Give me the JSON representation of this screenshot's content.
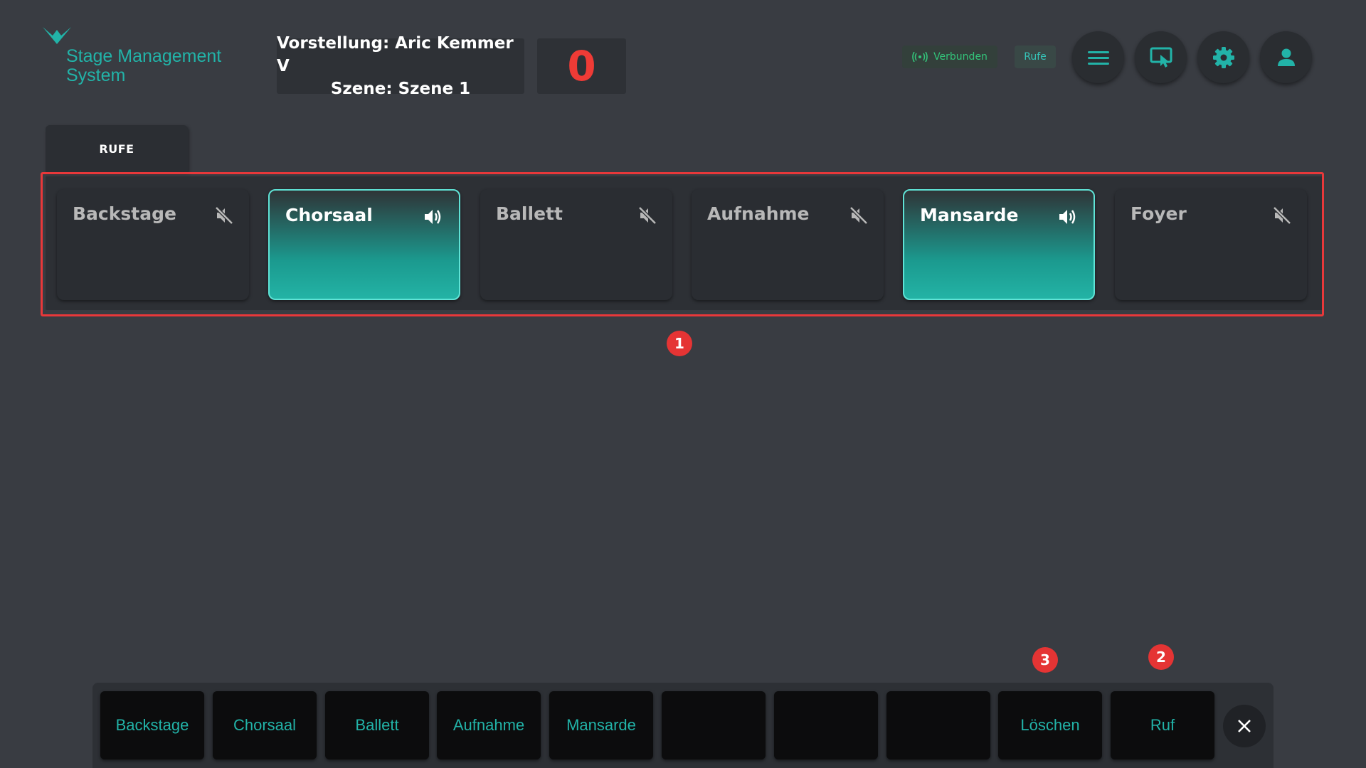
{
  "header": {
    "logo_text_line1": "Stage Management",
    "logo_text_line2": "System",
    "show_label": "Vorstellung: Aric Kemmer V",
    "scene_label": "Szene: Szene 1",
    "counter": "0",
    "status": "Verbunden",
    "rufe_badge": "Rufe",
    "buttons": [
      "menu-icon",
      "touch-screen-icon",
      "gear-icon",
      "user-icon"
    ]
  },
  "tab": {
    "label": "RUFE"
  },
  "stations": [
    {
      "label": "Backstage",
      "active": false,
      "icon": "muted-speaker-icon"
    },
    {
      "label": "Chorsaal",
      "active": true,
      "icon": "speaker-icon"
    },
    {
      "label": "Ballett",
      "active": false,
      "icon": "muted-speaker-icon"
    },
    {
      "label": "Aufnahme",
      "active": false,
      "icon": "muted-speaker-icon"
    },
    {
      "label": "Mansarde",
      "active": true,
      "icon": "speaker-icon"
    },
    {
      "label": "Foyer",
      "active": false,
      "icon": "muted-speaker-icon"
    }
  ],
  "markers": [
    "1",
    "2",
    "3"
  ],
  "dock": {
    "buttons": [
      "Backstage",
      "Chorsaal",
      "Ballett",
      "Aufnahme",
      "Mansarde",
      "",
      "",
      "",
      "Löschen",
      "Ruf"
    ]
  },
  "colors": {
    "background": "#393c42",
    "accent": "#22b3a8",
    "counter": "#ef3b36",
    "status_green": "#33c47a",
    "marker_red": "#e53434"
  }
}
